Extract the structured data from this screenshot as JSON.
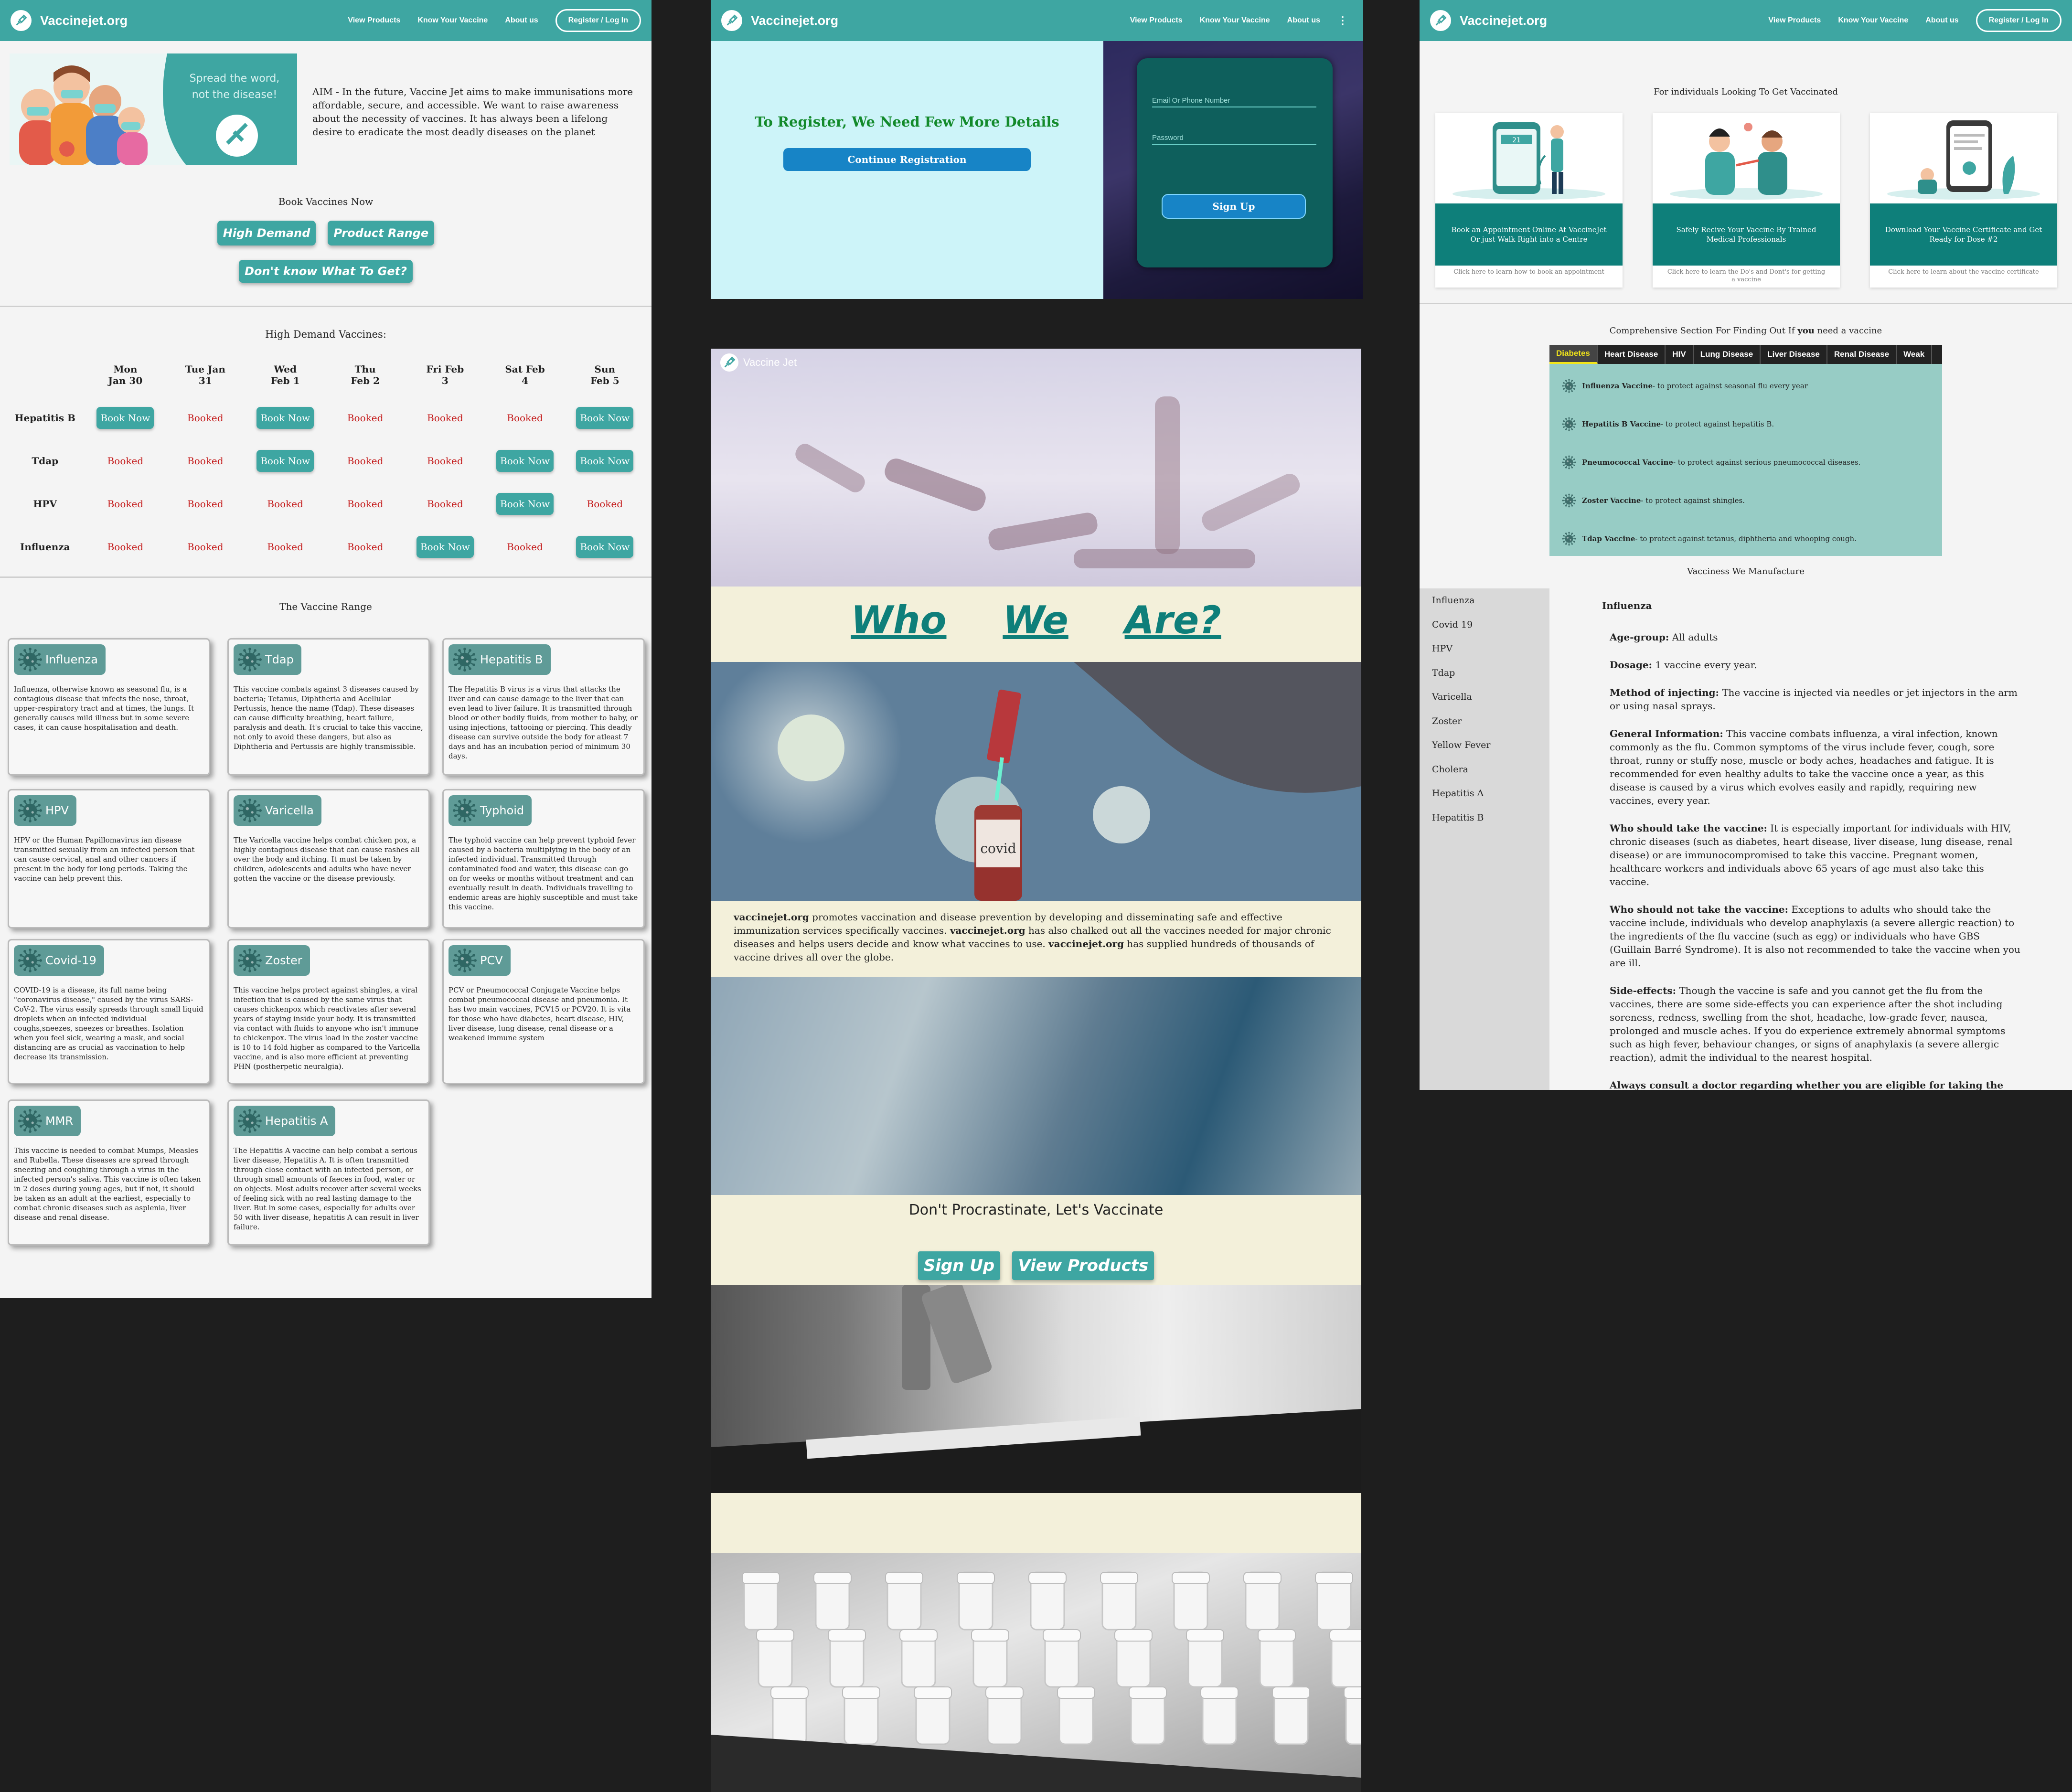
{
  "nav": {
    "brand": "Vaccinejet.org",
    "links": [
      "View Products",
      "Know Your Vaccine",
      "About us"
    ],
    "register": "Register / Log In"
  },
  "home": {
    "banner_line1": "Spread the word,",
    "banner_line2": "not the disease!",
    "aim": "AIM - In the future, Vaccine Jet aims to make immunisations more affordable, secure, and accessible. We want to raise awareness about the necessity of vaccines. It has always been a lifelong desire to eradicate the most deadly diseases on the planet",
    "book_title": "Book Vaccines Now",
    "btn_high": "High Demand",
    "btn_range": "Product Range",
    "btn_dont": "Don't know What To Get?",
    "schedule_title": "High Demand Vaccines:",
    "days": [
      "Mon Jan 30",
      "Tue Jan 31",
      "Wed Feb 1",
      "Thu Feb 2",
      "Fri Feb 3",
      "Sat Feb 4",
      "Sun Feb 5"
    ],
    "rows": [
      {
        "name": "Hepatitis B",
        "slots": [
          "Book Now",
          "Booked",
          "Book Now",
          "Booked",
          "Booked",
          "Booked",
          "Book Now"
        ]
      },
      {
        "name": "Tdap",
        "slots": [
          "Booked",
          "Booked",
          "Book Now",
          "Booked",
          "Booked",
          "Book Now",
          "Book Now"
        ]
      },
      {
        "name": "HPV",
        "slots": [
          "Booked",
          "Booked",
          "Booked",
          "Booked",
          "Booked",
          "Book Now",
          "Booked"
        ]
      },
      {
        "name": "Influenza",
        "slots": [
          "Booked",
          "Booked",
          "Booked",
          "Booked",
          "Book Now",
          "Booked",
          "Book Now"
        ]
      }
    ],
    "range_title": "The Vaccine Range",
    "cards": [
      {
        "name": "Influenza",
        "text": "Influenza, otherwise known as seasonal flu, is a contagious disease that infects the nose, throat, upper-respiratory tract and at times, the lungs. It generally causes mild illness but in some severe cases, it can cause hospitalisation and death."
      },
      {
        "name": "Tdap",
        "text": "This vaccine combats against 3 diseases caused by bacteria; Tetanus, Diphtheria and Acellular Pertussis, hence the name (Tdap). These diseases can cause difficulty breathing, heart failure, paralysis and death. It's crucial to take this vaccine, not only to avoid these dangers, but also as Diphtheria and Pertussis are highly transmissible."
      },
      {
        "name": "Hepatitis B",
        "text": "The Hepatitis B virus is a virus that attacks the liver and can cause damage to the liver that can even lead to liver failure. It is transmitted through blood or other bodily fluids, from mother to baby, or using injections, tattooing or piercing. This deadly disease can survive outside the body for atleast 7 days and has an incubation period of minimum 30 days."
      },
      {
        "name": "HPV",
        "text": "HPV or the Human Papillomavirus ian disease transmitted sexually from an infected person that can cause cervical, anal and other cancers if present in the body for long periods. Taking the vaccine can help prevent this."
      },
      {
        "name": "Varicella",
        "text": "The Varicella vaccine helps combat chicken pox, a highly contagious disease that can cause rashes all over the body and itching. It must be taken by children, adolescents and adults who have never gotten the vaccine or the disease previously."
      },
      {
        "name": "Typhoid",
        "text": "The typhoid vaccine can help prevent typhoid fever caused by a bacteria multiplying in the body of an infected individual. Transmitted through contaminated food and water, this disease can go on for weeks or months without treatment and can eventually result in death. Individuals travelling to endemic areas are highly susceptible and must take this vaccine."
      },
      {
        "name": "Covid-19",
        "text": "COVID-19 is a disease, its full name being \"coronavirus disease,\" caused by the virus SARS-CoV-2. The virus easily spreads through small liquid droplets when an infected individual coughs,sneezes, sneezes or breathes. Isolation when you feel sick, wearing a mask, and social distancing are as crucial as vaccination to help decrease its transmission."
      },
      {
        "name": "Zoster",
        "text": "This vaccine helps protect against shingles, a viral infection that is caused by the same virus that causes chickenpox which reactivates after several years of staying inside your body. It is transmitted via contact with fluids to anyone who isn't immune to chickenpox. The virus load in the zoster vaccine is 10 to 14 fold higher as compared to the Varicella vaccine, and is also more efficient at preventing PHN (postherpetic neuralgia)."
      },
      {
        "name": "PCV",
        "text": "PCV or Pneumococcal Conjugate Vaccine helps combat pneumococcal disease and pneumonia. It has two main vaccines, PCV15 or PCV20. It is vita for those who have diabetes, heart disease, HIV, liver disease, lung disease, renal disease or a weakened immune system"
      },
      {
        "name": "MMR",
        "text": "This vaccine is needed to combat Mumps, Measles and Rubella. These diseases are spread through sneezing and coughing through a virus in the infected person's saliva. This vaccine is often taken in 2 doses during young ages, but if not, it should be taken as an adult at the earliest, especially to combat chronic diseases such as asplenia, liver disease and renal disease."
      },
      {
        "name": "Hepatitis A",
        "text": "The Hepatitis A vaccine can help combat a serious liver disease, Hepatitis A. It is often transmitted through close contact with an infected person, or through small amounts of faeces in food, water or on objects. Most adults recover after several weeks of feeling sick with no real lasting damage to the liver. But in some cases, especially for adults over 50 with liver disease, hepatitis A can result in liver failure."
      }
    ]
  },
  "register": {
    "title": "To Register, We Need Few More Details",
    "continue": "Continue Registration",
    "email_placeholder": "Email Or Phone Number",
    "password_placeholder": "Password",
    "signup": "Sign Up"
  },
  "about": {
    "brand_overlay": "Vaccine Jet",
    "who": [
      "Who",
      "We",
      "Are?"
    ],
    "brand_bold": "vaccinejet.org",
    "para_1": " promotes vaccination and disease prevention by developing and disseminating safe and effective immunization services specifically vaccines. ",
    "para_2": " has also chalked out all the vaccines needed for major chronic diseases and helps users decide and know what vaccines to use. ",
    "para_3": " has supplied hundreds of thousands of vaccine drives all over the globe.",
    "procrastinate": "Don't Procrastinate, Let's Vaccinate",
    "signup": "Sign Up",
    "products": "View Products",
    "vial_label": "covid"
  },
  "products": {
    "heading": "For individuals Looking To Get Vaccinated",
    "cards": [
      {
        "title": "Book an Appointment Online At VaccineJet Or just Walk Right into a Centre",
        "link": "Click here to learn how to book an appointment",
        "cal": "21"
      },
      {
        "title": "Safely Recive Your Vaccine By Trained Medical Professionals",
        "link": "Click here to learn the Do's and Dont's for getting a vaccine"
      },
      {
        "title": "Download Your Vaccine Certificate and Get Ready for Dose #2",
        "link": "Click here to learn about the vaccine certificate"
      }
    ],
    "section_pre": "Comprehensive Section For Finding Out If ",
    "section_you": "you",
    "section_post": " need a vaccine",
    "tabs": [
      "Diabetes",
      "Heart Disease",
      "HIV",
      "Lung Disease",
      "Liver Disease",
      "Renal Disease",
      "Weak"
    ],
    "diabetes_vaccines": [
      {
        "name": "Influenza Vaccine",
        "desc": " - to protect against seasonal flu every year"
      },
      {
        "name": "Hepatitis B Vaccine",
        "desc": " - to protect against hepatitis B."
      },
      {
        "name": "Pneumococcal Vaccine",
        "desc": " - to protect against serious pneumococcal diseases."
      },
      {
        "name": "Zoster Vaccine",
        "desc": " - to protect against shingles."
      },
      {
        "name": "Tdap Vaccine",
        "desc": " - to protect against tetanus, diphtheria and whooping cough."
      }
    ],
    "manufacture_title": "Vacciness We Manufacture",
    "sidebar": [
      "Influenza",
      "Covid 19",
      "HPV",
      "Tdap",
      "Varicella",
      "Zoster",
      "Yellow Fever",
      "Cholera",
      "Hepatitis A",
      "Hepatitis B"
    ],
    "detail": {
      "title": "Influenza",
      "age_label": "Age-group:",
      "age": " All adults",
      "dosage_label": "Dosage:",
      "dosage": " 1 vaccine every year.",
      "method_label": "Method of injecting:",
      "method": " The vaccine is injected via needles or jet injectors in the arm or using nasal sprays.",
      "general_label": "General Information:",
      "general": " This vaccine combats influenza, a viral infection, known commonly as the flu. Common symptoms of the virus include fever, cough, sore throat, runny or stuffy nose, muscle or body aches, headaches and fatigue. It is recommended for even healthy adults to take the vaccine once a year, as this disease is caused by a virus which evolves easily and rapidly, requiring new vaccines, every year.",
      "who_label": "Who should take the vaccine:",
      "who": " It is especially important for individuals with HIV, chronic diseases (such as diabetes, heart disease, liver disease, lung disease, renal disease) or are immunocompromised to take this vaccine. Pregnant women, healthcare workers and individuals above 65 years of age must also take this vaccine.",
      "whonot_label": "Who should not take the vaccine:",
      "whonot": " Exceptions to adults who should take the vaccine include, individuals who develop anaphylaxis (a severe allergic reaction) to the ingredients of the flu vaccine (such as egg) or individuals who have GBS (Guillain Barré Syndrome). It is also not recommended to take the vaccine when you are ill.",
      "side_label": "Side-effects:",
      "side": " Though the vaccine is safe and you cannot get the flu from the vaccines, there are some side-effects you can experience after the shot including soreness, redness, swelling from the shot, headache, low-grade fever, nausea, prolonged and muscle aches. If you do experience extremely abnormal symptoms such as high fever, behaviour changes, or signs of anaphylaxis (a severe allergic reaction), admit the individual to the nearest hospital.",
      "closing": "Always consult a doctor regarding whether you are eligible for taking the vaccine, and to help decide which vaccine is best for you."
    }
  },
  "colors": {
    "teal": "#3ea6a2",
    "dark_teal": "#0e5f5c",
    "booked": "#c41a1a",
    "cream": "#f3f0da",
    "light_cyan": "#cdf4f9"
  }
}
